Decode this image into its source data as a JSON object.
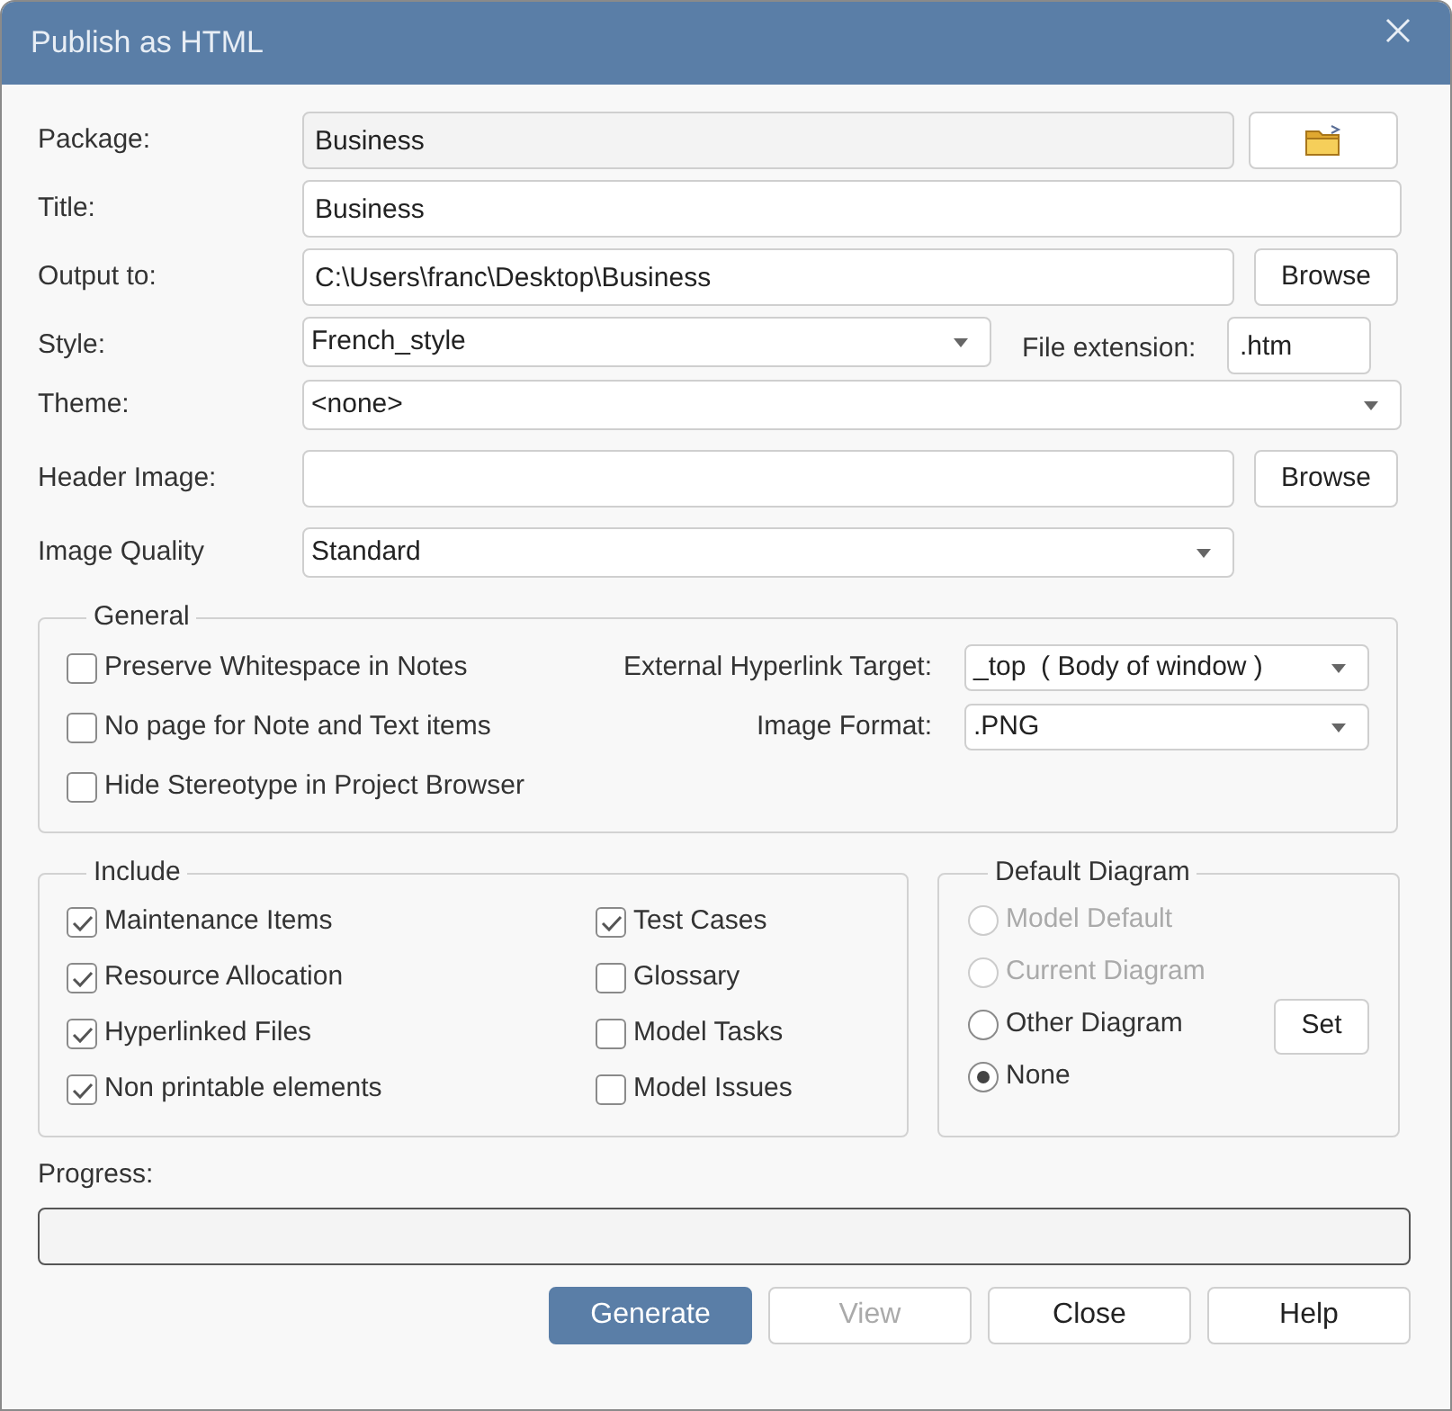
{
  "window": {
    "title": "Publish as HTML"
  },
  "package": {
    "label": "Package:",
    "value": "Business",
    "readonly": true
  },
  "title": {
    "label": "Title:",
    "value": "Business",
    "readonly": false
  },
  "output_to": {
    "label": "Output to:",
    "value": "C:\\Users\\franc\\Desktop\\Business",
    "readonly": false,
    "button": "Browse"
  },
  "style": {
    "label": "Style:",
    "value": "French_style"
  },
  "file_extension": {
    "label": "File extension:",
    "value": ".htm"
  },
  "theme": {
    "label": "Theme:",
    "value": "<none>"
  },
  "header_image": {
    "label": "Header Image:",
    "readonly": false,
    "button": "Browse"
  },
  "image_quality": {
    "label": "Image Quality",
    "value": "Standard"
  },
  "general": {
    "title": "General",
    "options": [
      {
        "label": "Preserve Whitespace in Notes",
        "checked": false
      },
      {
        "label": "No page for Note and Text items",
        "checked": false
      },
      {
        "label": "Hide Stereotype in Project Browser",
        "checked": false
      }
    ],
    "dropdowns": [
      {
        "label": "External Hyperlink Target:",
        "value": "_top  ( Body of window )"
      },
      {
        "label": "Image Format:",
        "value": ".PNG"
      }
    ]
  },
  "include": {
    "title": "Include",
    "columns": [
      [
        {
          "label": "Maintenance Items",
          "checked": true
        },
        {
          "label": "Resource Allocation",
          "checked": true
        },
        {
          "label": "Hyperlinked Files",
          "checked": true
        },
        {
          "label": "Non printable elements",
          "checked": true
        }
      ],
      [
        {
          "label": "Test Cases",
          "checked": true
        },
        {
          "label": "Glossary",
          "checked": false
        },
        {
          "label": "Model Tasks",
          "checked": false
        },
        {
          "label": "Model Issues",
          "checked": false
        }
      ]
    ]
  },
  "default_diagram": {
    "title": "Default Diagram",
    "set_button": "Set",
    "options": [
      {
        "label": "Model Default",
        "selected": false,
        "disabled": true
      },
      {
        "label": "Current Diagram",
        "selected": false,
        "disabled": true
      },
      {
        "label": "Other Diagram",
        "selected": false,
        "disabled": false
      },
      {
        "label": "None",
        "selected": true,
        "disabled": false
      }
    ]
  },
  "progress": {
    "label": "Progress:",
    "level": 0
  },
  "buttons": [
    {
      "label": "Generate",
      "primary": true,
      "disabled": false
    },
    {
      "label": "View",
      "primary": false,
      "disabled": true
    },
    {
      "label": "Close",
      "primary": false,
      "disabled": false
    },
    {
      "label": "Help",
      "primary": false,
      "disabled": false
    }
  ]
}
